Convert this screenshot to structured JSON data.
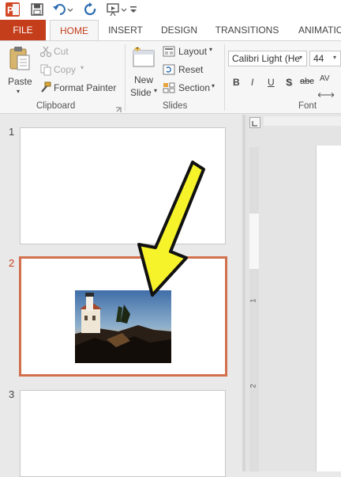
{
  "app": {
    "accent": "#c43e1c",
    "selected_thumb_border": "#d2704e"
  },
  "quick_access": {
    "icons": [
      "powerpoint-logo-icon",
      "save-icon",
      "undo-icon",
      "redo-icon",
      "present-icon",
      "customize-icon"
    ]
  },
  "tabs": {
    "file": "FILE",
    "home": "HOME",
    "insert": "INSERT",
    "design": "DESIGN",
    "transitions": "TRANSITIONS",
    "animations": "ANIMATIO"
  },
  "ribbon": {
    "clipboard": {
      "paste": "Paste",
      "cut": "Cut",
      "copy": "Copy",
      "format_painter": "Format Painter",
      "label": "Clipboard"
    },
    "slides": {
      "new_slide_line1": "New",
      "new_slide_line2": "Slide",
      "layout": "Layout",
      "reset": "Reset",
      "section": "Section",
      "label": "Slides"
    },
    "font": {
      "font_name": "Calibri Light (He",
      "font_size": "44",
      "bold": "B",
      "italic": "I",
      "underline": "U",
      "shadow": "S",
      "strikethrough": "abc",
      "spacing": "AV",
      "label": "Font"
    }
  },
  "slides_pane": {
    "slide_numbers": [
      "1",
      "2",
      "3"
    ],
    "selected": "2"
  },
  "ruler": {
    "left_marks": [
      "1",
      "2"
    ]
  }
}
